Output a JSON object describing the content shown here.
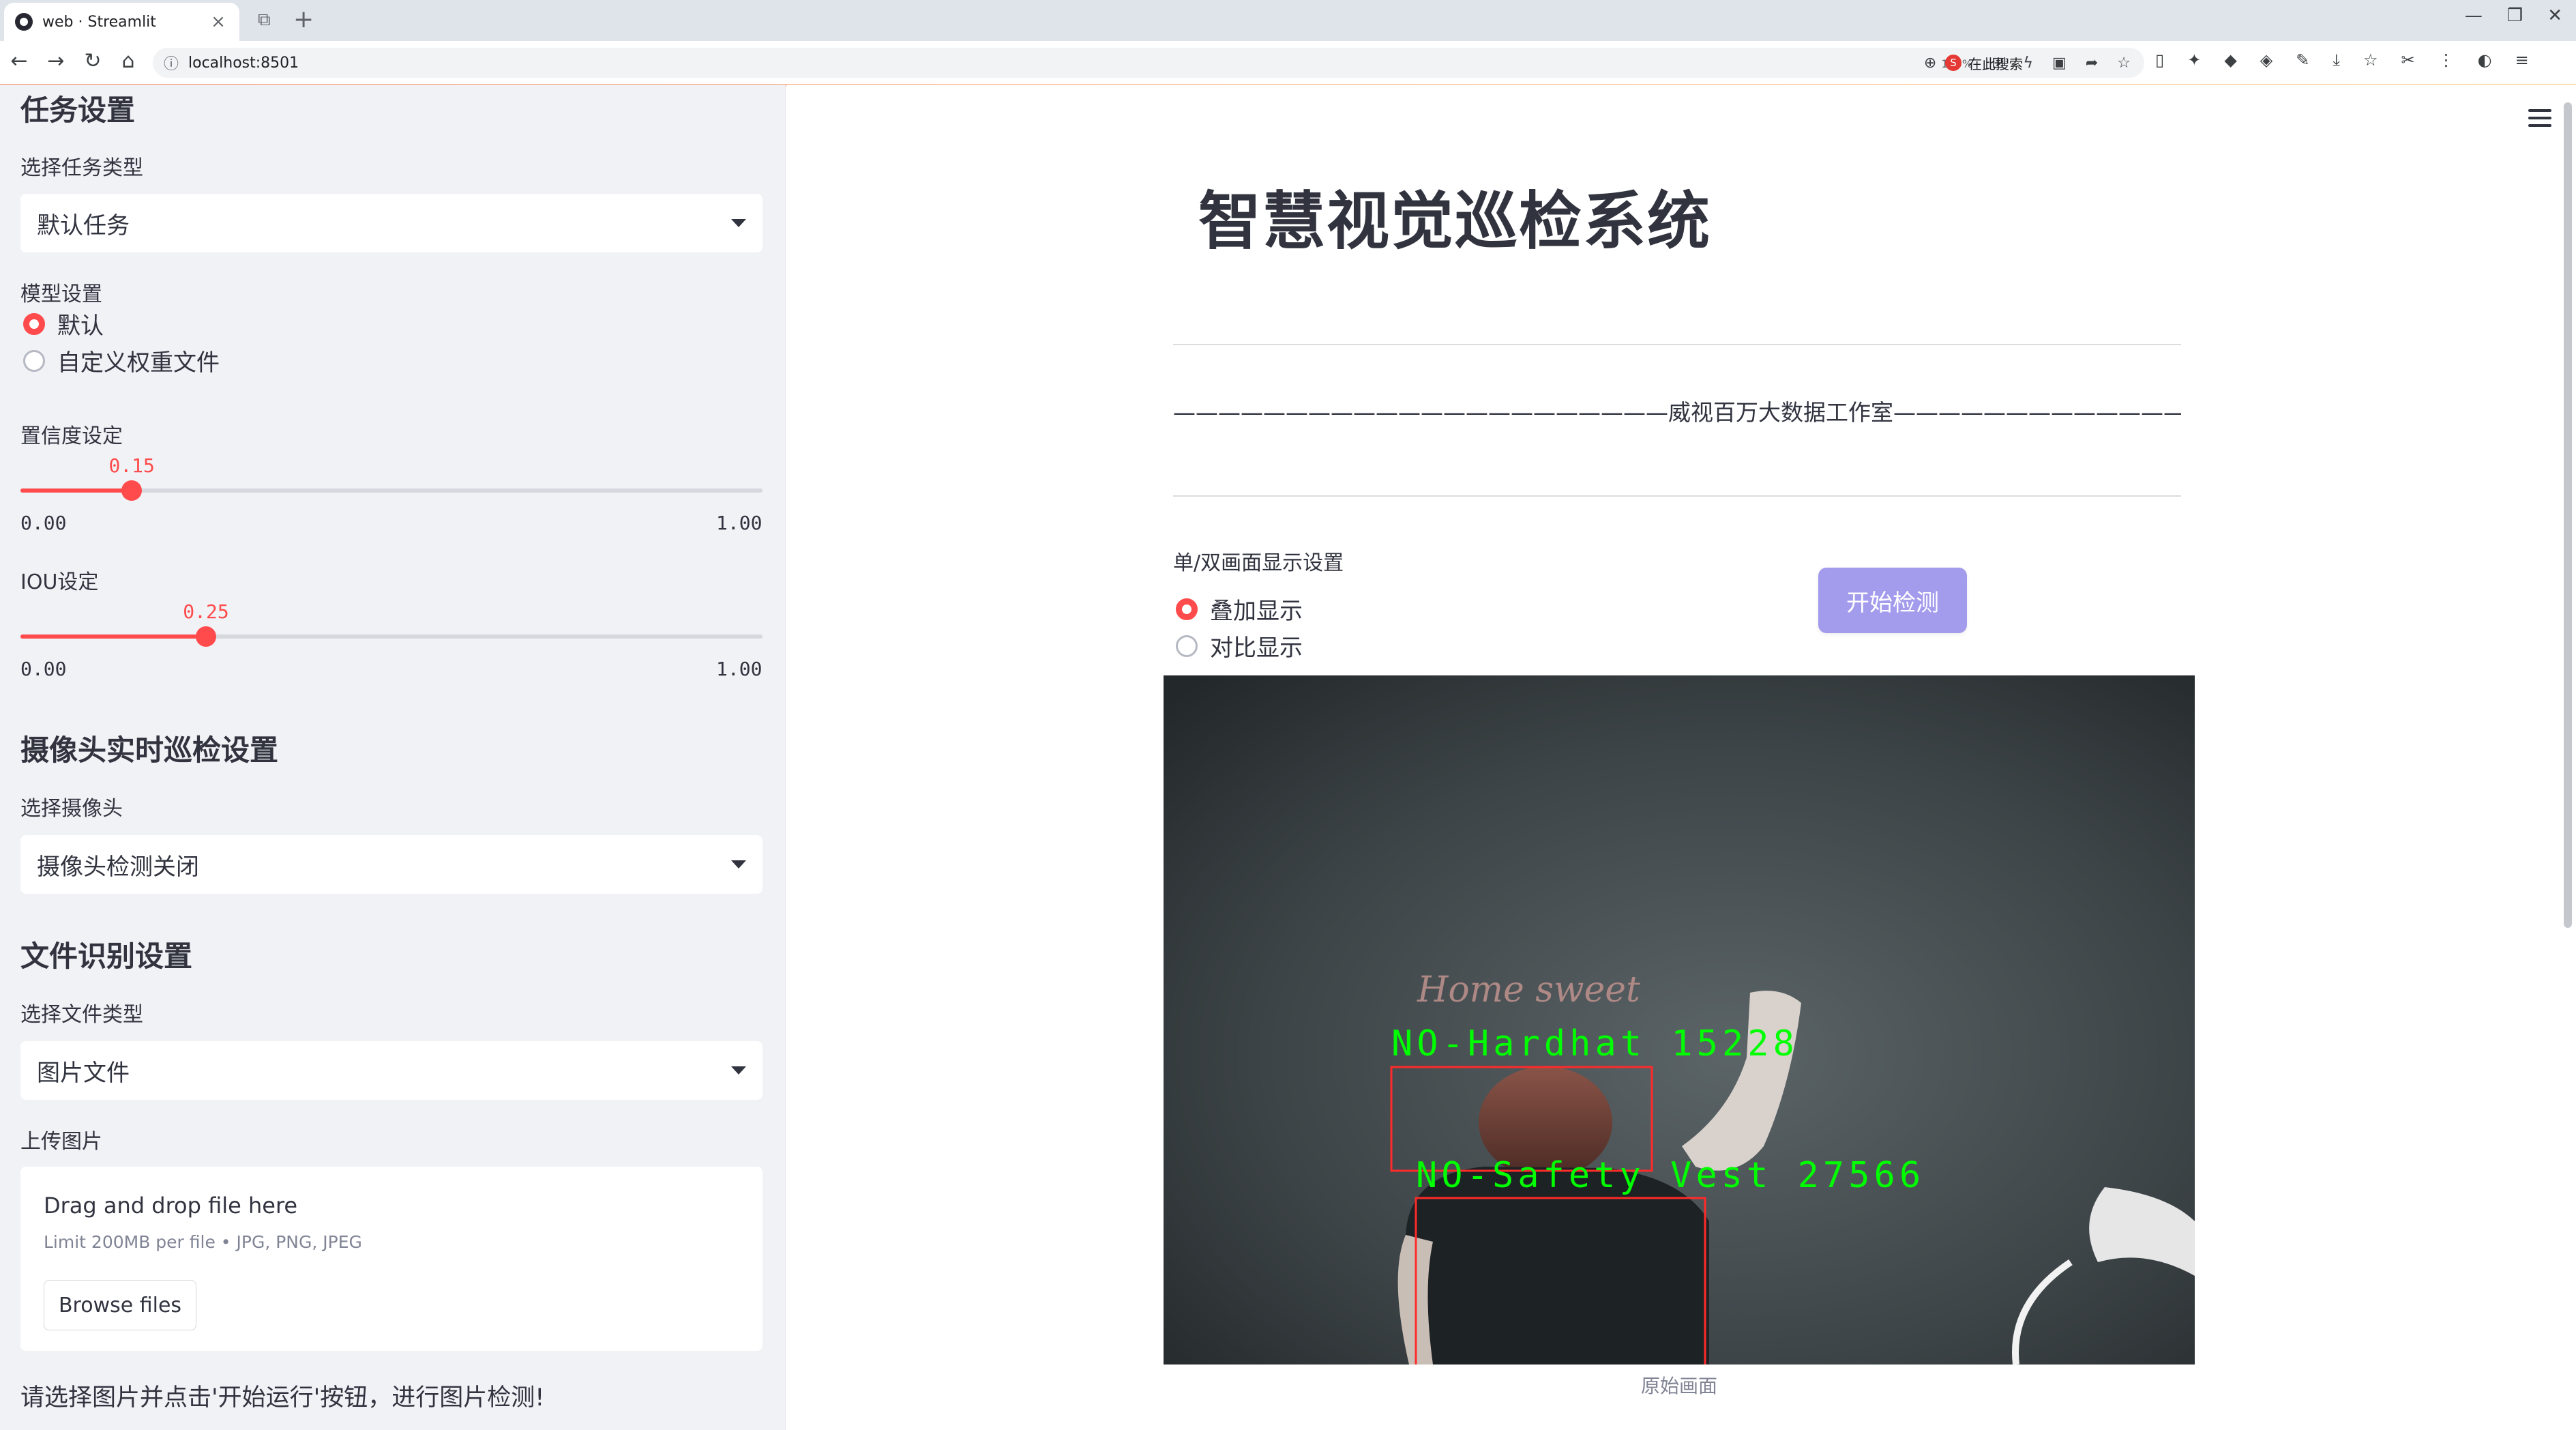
{
  "browser": {
    "tab_title": "web · Streamlit",
    "url": "localhost:8501",
    "zoom_level": "140%",
    "search_placeholder": "在此搜索"
  },
  "sidebar": {
    "task_section_title": "任务设置",
    "task_type_label": "选择任务类型",
    "task_type_value": "默认任务",
    "model_label": "模型设置",
    "model_options": [
      "默认",
      "自定义权重文件"
    ],
    "model_selected": 0,
    "confidence": {
      "label": "置信度设定",
      "value": 0.15,
      "value_text": "0.15",
      "min_text": "0.00",
      "max_text": "1.00",
      "min": 0,
      "max": 1
    },
    "iou": {
      "label": "IOU设定",
      "value": 0.25,
      "value_text": "0.25",
      "min_text": "0.00",
      "max_text": "1.00",
      "min": 0,
      "max": 1
    },
    "camera_section_title": "摄像头实时巡检设置",
    "camera_label": "选择摄像头",
    "camera_value": "摄像头检测关闭",
    "file_section_title": "文件识别设置",
    "file_type_label": "选择文件类型",
    "file_type_value": "图片文件",
    "upload_label": "上传图片",
    "upload_title": "Drag and drop file here",
    "upload_limit": "Limit 200MB per file • JPG, PNG, JPEG",
    "browse_label": "Browse files",
    "instruction": "请选择图片并点击'开始运行'按钮，进行图片检测!"
  },
  "main": {
    "title": "智慧视觉巡检系统",
    "subtitle": "——————————————————————威视百万大数据工作室———————————————————————",
    "display_label": "单/双画面显示设置",
    "display_options": [
      "叠加显示",
      "对比显示"
    ],
    "display_selected": 0,
    "start_button": "开始检测",
    "board_text": "Home sweet",
    "detections": [
      {
        "label": "NO-Hardhat 15228",
        "color": "#00ff00",
        "box_color": "#ff2a2a"
      },
      {
        "label": "NO-Safety Vest 27566",
        "color": "#00ff00",
        "box_color": "#ff2a2a"
      }
    ],
    "caption": "原始画面"
  },
  "colors": {
    "accent": "#ff4b4b",
    "button": "#a39cec",
    "sidebar_bg": "#f0f2f6"
  }
}
